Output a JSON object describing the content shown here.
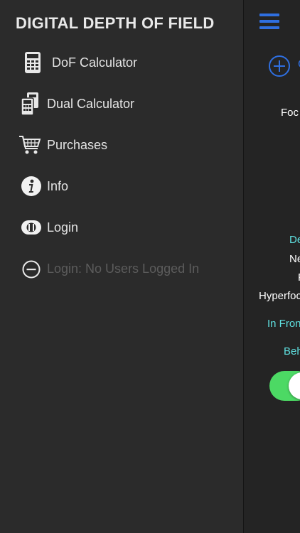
{
  "drawer": {
    "title": "DIGITAL DEPTH OF FIELD",
    "items": [
      {
        "label": "DoF Calculator",
        "icon": "calculator-icon",
        "enabled": true
      },
      {
        "label": "Dual Calculator",
        "icon": "dual-calculator-icon",
        "enabled": true
      },
      {
        "label": "Purchases",
        "icon": "shopping-cart-icon",
        "enabled": true
      },
      {
        "label": "Info",
        "icon": "info-icon",
        "enabled": true
      },
      {
        "label": "Login",
        "icon": "toggle-login-icon",
        "enabled": true
      },
      {
        "label": "Login: No Users Logged In",
        "icon": "minus-circle-icon",
        "enabled": false
      }
    ]
  },
  "main": {
    "add_label": "C",
    "labels": {
      "focal": "Foc",
      "depth": "De",
      "near": "Ne",
      "far": "F",
      "hyperfocal": "Hyperfoc",
      "in_front": "In Fron",
      "behind": "Beh"
    },
    "toggle_on": true
  },
  "colors": {
    "accent": "#2f6fe0",
    "teal": "#5fe0e0",
    "toggle_on": "#4cd964"
  }
}
